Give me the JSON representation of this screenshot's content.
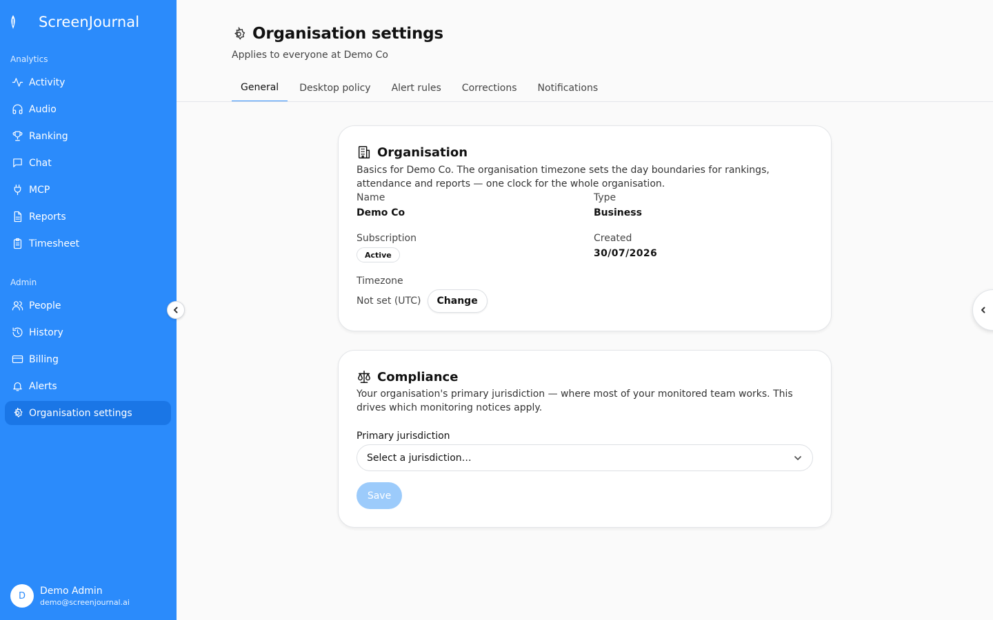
{
  "app": {
    "name": "ScreenJournal"
  },
  "sidebar": {
    "analytics_label": "Analytics",
    "analytics_items": [
      {
        "label": "Activity",
        "icon": "activity-icon"
      },
      {
        "label": "Audio",
        "icon": "headphones-icon"
      },
      {
        "label": "Ranking",
        "icon": "trophy-icon"
      },
      {
        "label": "Chat",
        "icon": "chat-icon"
      },
      {
        "label": "MCP",
        "icon": "plug-icon"
      },
      {
        "label": "Reports",
        "icon": "document-icon"
      },
      {
        "label": "Timesheet",
        "icon": "clipboard-icon"
      }
    ],
    "admin_label": "Admin",
    "admin_items": [
      {
        "label": "People",
        "icon": "users-icon"
      },
      {
        "label": "History",
        "icon": "history-icon"
      },
      {
        "label": "Billing",
        "icon": "credit-card-icon"
      },
      {
        "label": "Alerts",
        "icon": "bell-icon"
      },
      {
        "label": "Organisation settings",
        "icon": "gear-icon",
        "active": true
      }
    ],
    "user": {
      "initial": "D",
      "name": "Demo Admin",
      "email": "demo@screenjournal.ai"
    }
  },
  "header": {
    "title": "Organisation settings",
    "subtitle": "Applies to everyone at Demo Co"
  },
  "tabs": [
    {
      "label": "General",
      "active": true
    },
    {
      "label": "Desktop policy"
    },
    {
      "label": "Alert rules"
    },
    {
      "label": "Corrections"
    },
    {
      "label": "Notifications"
    }
  ],
  "organisation_card": {
    "title": "Organisation",
    "description": "Basics for Demo Co. The organisation timezone sets the day boundaries for rankings, attendance and reports — one clock for the whole organisation.",
    "name_label": "Name",
    "name_value": "Demo Co",
    "type_label": "Type",
    "type_value": "Business",
    "subscription_label": "Subscription",
    "subscription_value": "Active",
    "created_label": "Created",
    "created_value": "30/07/2026",
    "timezone_label": "Timezone",
    "timezone_value": "Not set (UTC)",
    "change_label": "Change"
  },
  "compliance_card": {
    "title": "Compliance",
    "description": "Your organisation's primary jurisdiction — where most of your monitored team works. This drives which monitoring notices apply.",
    "jurisdiction_label": "Primary jurisdiction",
    "jurisdiction_placeholder": "Select a jurisdiction…",
    "save_label": "Save"
  },
  "colors": {
    "brand": "#2b8bfb",
    "active_nav": "#1a76e6",
    "save_disabled": "#9ccbfb"
  }
}
